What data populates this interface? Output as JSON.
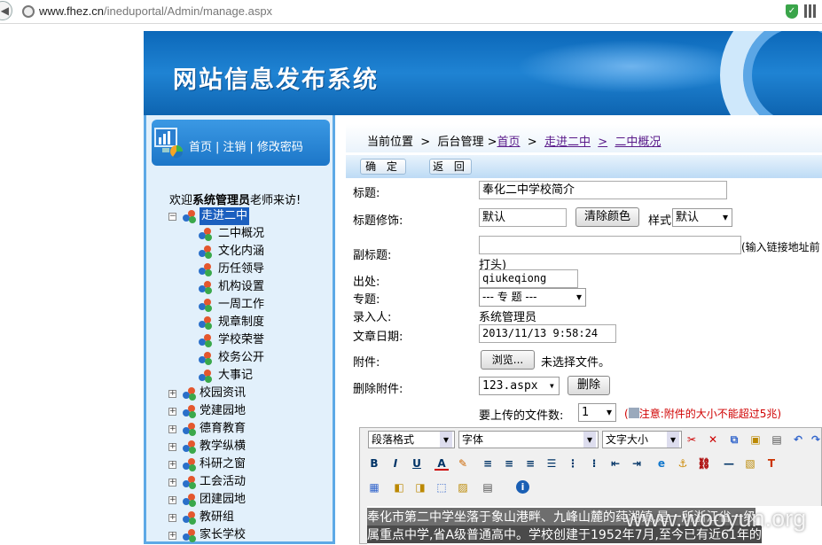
{
  "browser": {
    "url_host": "www.fhez.cn",
    "url_path": "/ineduportal/Admin/manage.aspx"
  },
  "banner": {
    "title": "网站信息发布系统"
  },
  "sidebar": {
    "nav": [
      "首页",
      "注销",
      "修改密码"
    ],
    "separator": "|",
    "welcome_prefix": "欢迎",
    "welcome_user": "系统管理员",
    "welcome_suffix": "老师来访!",
    "tree": [
      {
        "label": "走进二中",
        "expanded": true,
        "selected": true,
        "children": [
          "二中概况",
          "文化内涵",
          "历任领导",
          "机构设置",
          "一周工作",
          "规章制度",
          "学校荣誉",
          "校务公开",
          "大事记"
        ]
      },
      {
        "label": "校园资讯"
      },
      {
        "label": "党建园地"
      },
      {
        "label": "德育教育"
      },
      {
        "label": "教学纵横"
      },
      {
        "label": "科研之窗"
      },
      {
        "label": "工会活动"
      },
      {
        "label": "团建园地"
      },
      {
        "label": "教研组"
      },
      {
        "label": "家长学校"
      }
    ]
  },
  "breadcrumb": {
    "prefix": "当前位置",
    "sep1": ">",
    "item1": "后台管理",
    "sep2": ">",
    "link1": "首页",
    "sep3": ">",
    "link2": "走进二中",
    "sep4": ">",
    "link3": "二中概况"
  },
  "actions": {
    "confirm": "确 定",
    "back": "返 回"
  },
  "form": {
    "title_label": "标题:",
    "title_value": "奉化二中学校简介",
    "decor_label": "标题修饰:",
    "decor_value": "默认",
    "clear_color": "清除颜色",
    "style_label": "样式",
    "style_value": "默认",
    "subtitle_label": "副标题:",
    "subtitle_hint": "(输入链接地址前",
    "subtitle_hint2": "打头)",
    "source_label": "出处:",
    "source_value": "qiukeqiong",
    "topic_label": "专题:",
    "topic_value": "--- 专 题 ---",
    "author_label": "录入人:",
    "author_value": "系统管理员",
    "date_label": "文章日期:",
    "date_value": "2013/11/13 9:58:24",
    "attach_label": "附件:",
    "browse": "浏览...",
    "no_file": "未选择文件。",
    "delete_attach_label": "删除附件:",
    "delete_attach_value": "123.aspx",
    "delete_btn": "删除",
    "upload_count_label": "要上传的文件数:",
    "upload_count_value": "1",
    "note_open": "(",
    "note_text": "注意:附件的大小不能超过5兆)"
  },
  "editor": {
    "paragraph_format": "段落格式",
    "font": "字体",
    "font_size": "文字大小",
    "content_line1": "奉化市第二中学坐落于象山港畔、九峰山麓的莼湖镇,是一所浙江省一级",
    "content_line2": "属重点中学,省A级普通高中。学校创建于1952年7月,至今已有近61年的"
  },
  "watermark": "www.wooyun.org"
}
